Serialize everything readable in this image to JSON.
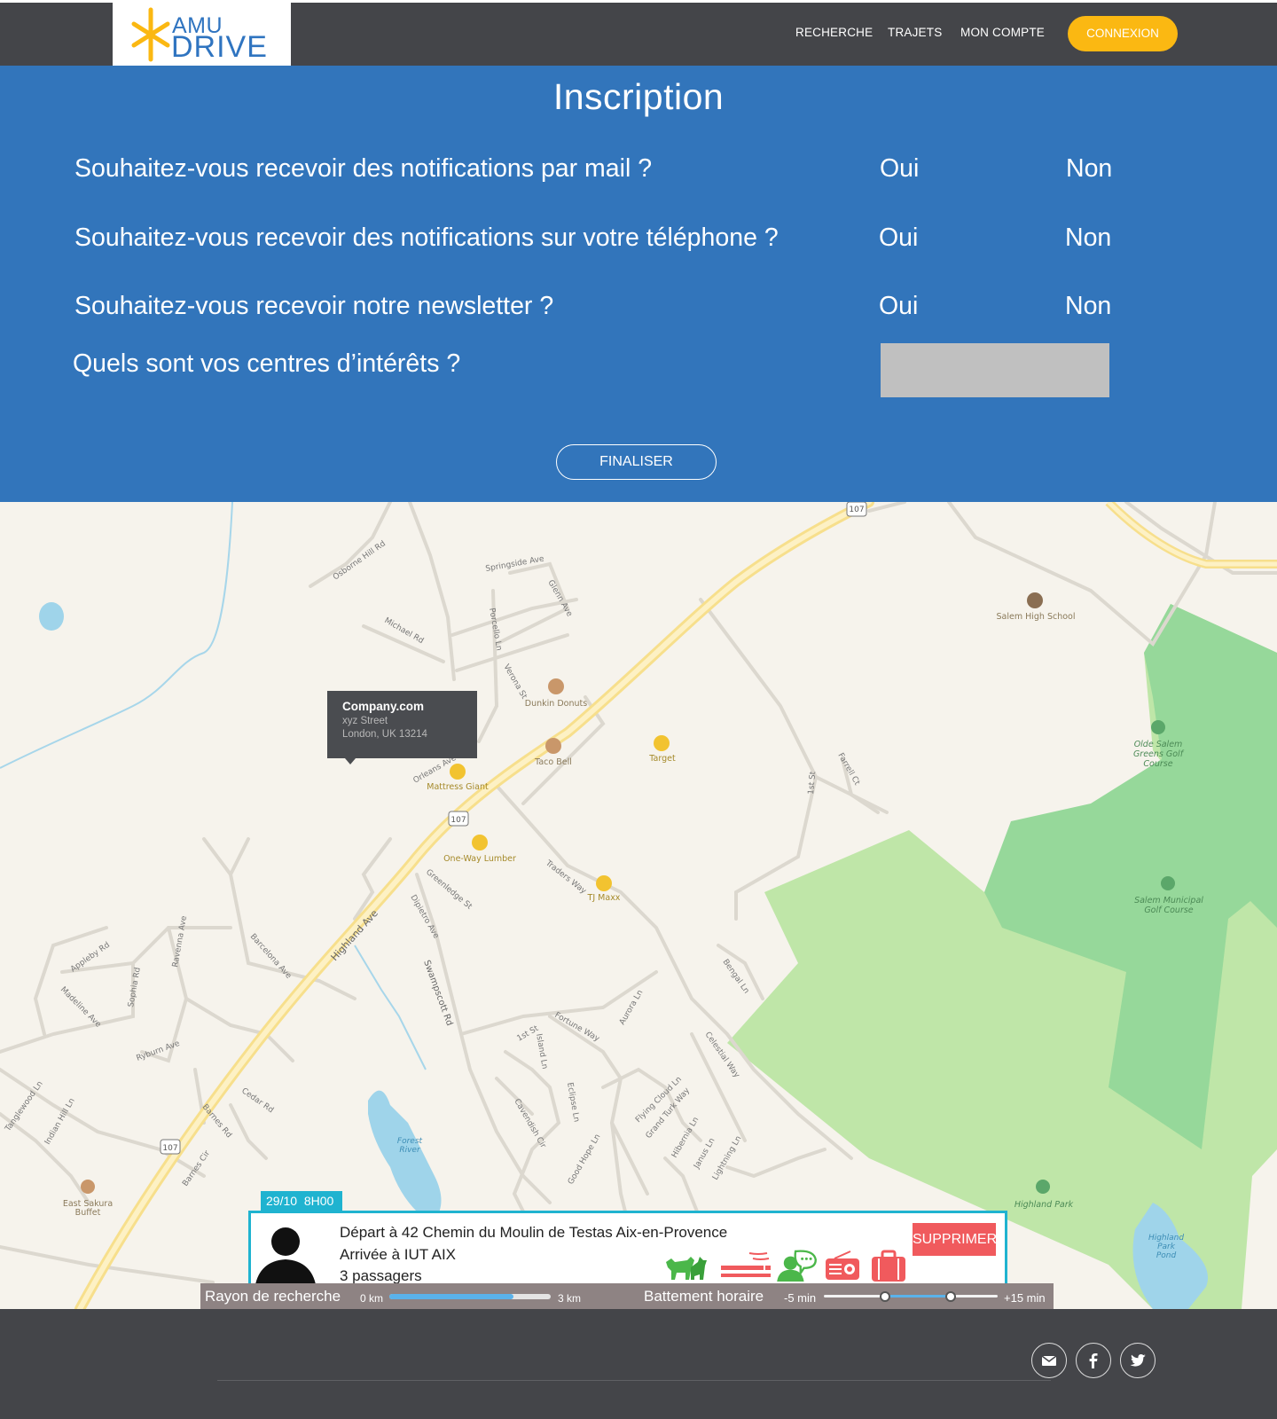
{
  "header": {
    "logo_top": "AMU",
    "logo_bottom": "DRIVE",
    "nav": [
      "RECHERCHE",
      "TRAJETS",
      "MON COMPTE"
    ],
    "login_label": "CONNEXION",
    "brand_color": "#2f74c0",
    "accent_color": "#fbb812"
  },
  "form": {
    "title": "Inscription",
    "questions": [
      {
        "text": "Souhaitez-vous recevoir des notifications par mail ?",
        "yes": "Oui",
        "no": "Non"
      },
      {
        "text": "Souhaitez-vous recevoir des notifications sur votre téléphone ?",
        "yes": "Oui",
        "no": "Non"
      },
      {
        "text": "Souhaitez-vous recevoir notre newsletter ?",
        "yes": "Oui",
        "no": "Non"
      }
    ],
    "interests_label": "Quels sont vos centres d’intérêts ?",
    "interests_value": "",
    "submit_label": "FINALISER",
    "bg_color": "#3275bb"
  },
  "map": {
    "popup": {
      "name": "Company.com",
      "street": "xyz Street",
      "city": "London, UK 13214"
    },
    "places": [
      "Salem High School",
      "Dunkin Donuts",
      "Taco Bell",
      "Target",
      "Mattress Giant",
      "One-Way Lumber",
      "TJ Maxx",
      "Olde Salem Greens Golf Course",
      "Salem Municipal Golf Course",
      "Highland Park",
      "East Sakura Buffet",
      "Forest River",
      "Highland Park Pond"
    ],
    "streets": [
      "Osborne Hill Rd",
      "Springside Ave",
      "Michael Rd",
      "Porcello Ln",
      "Glenn Ave",
      "Verona St",
      "Orleans Ave",
      "Highland Ave",
      "Greenledge St",
      "Dipietro Ave",
      "Traders Way",
      "Swampscott Rd",
      "Barcelona Ave",
      "Ravenna Ave",
      "Appleby Rd",
      "Madeline Ave",
      "Sophia Rd",
      "Ryburn Ave",
      "Cedar Rd",
      "Barnes Rd",
      "Barnes Cir",
      "Tanglewood Ln",
      "Indian Hill Ln",
      "1st St",
      "Fortune Way",
      "Aurora Ln",
      "Island Ln",
      "Bengal Ln",
      "Celestial Way",
      "Eclipse Ln",
      "Cavendish Cir",
      "Good Hope Ln",
      "Flying Cloud Ln",
      "Grand Turk Way",
      "Hibernia Ln",
      "Janus Ln",
      "Lightning Ln",
      "Farrell Ct",
      "1st St"
    ],
    "route_number": "107"
  },
  "ride": {
    "date": "29/10",
    "time": "8H00",
    "departure": "Départ à 42 Chemin du Moulin de Testas Aix-en-Provence",
    "arrival": "Arrivée à IUT AIX",
    "passengers": "3 passagers",
    "delete_label": "SUPPRIMER",
    "amenities": [
      "animals-icon",
      "smoking-icon",
      "chat-icon",
      "radio-icon",
      "luggage-icon"
    ]
  },
  "filters": {
    "radius_label": "Rayon de recherche",
    "radius_min": "0 km",
    "radius_max": "3 km",
    "radius_value_fraction": 0.77,
    "time_label": "Battement horaire",
    "time_min": "-5 min",
    "time_max": "+15 min",
    "time_range_fraction": [
      0.35,
      0.73
    ]
  },
  "footer": {
    "social": [
      "mail-icon",
      "facebook-icon",
      "twitter-icon"
    ]
  }
}
